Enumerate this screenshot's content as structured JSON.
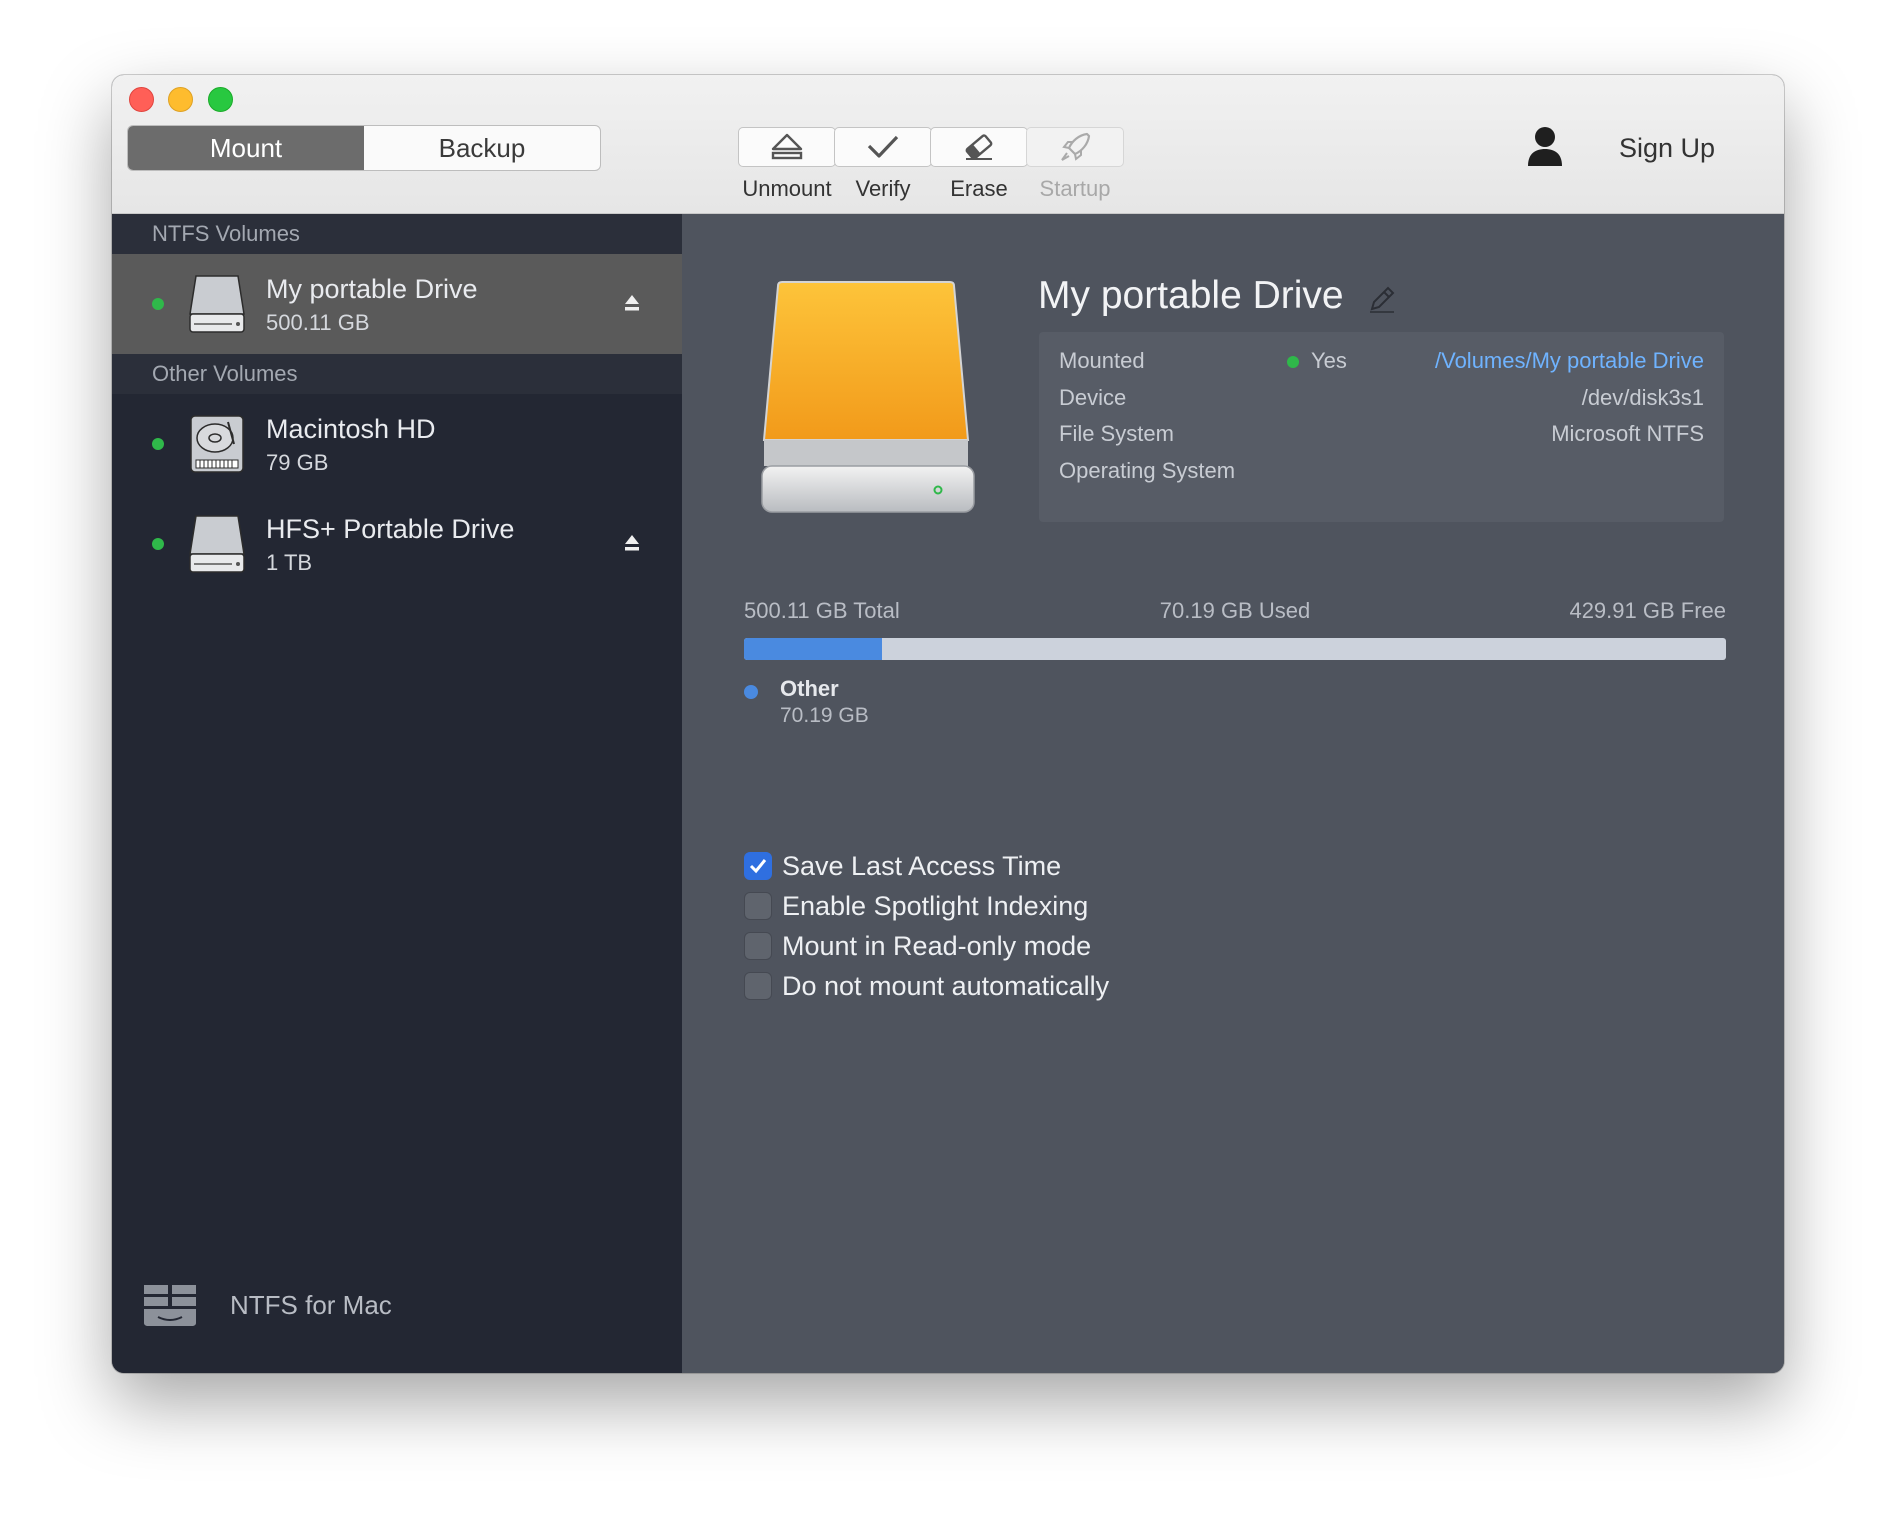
{
  "segments": {
    "mount": "Mount",
    "backup": "Backup"
  },
  "toolbar": {
    "unmount": "Unmount",
    "verify": "Verify",
    "erase": "Erase",
    "startup": "Startup"
  },
  "account": {
    "sign_up": "Sign Up"
  },
  "sidebar": {
    "ntfs_header": "NTFS Volumes",
    "other_header": "Other Volumes",
    "ntfs_volumes": [
      {
        "name": "My portable Drive",
        "size": "500.11 GB"
      }
    ],
    "other_volumes": [
      {
        "name": "Macintosh HD",
        "size": "79 GB"
      },
      {
        "name": "HFS+ Portable Drive",
        "size": "1 TB"
      }
    ],
    "brand": "NTFS for Mac"
  },
  "detail": {
    "title": "My portable Drive",
    "info": {
      "mounted_label": "Mounted",
      "mounted_value": "Yes",
      "mount_path": "/Volumes/My portable Drive",
      "device_label": "Device",
      "device_value": "/dev/disk3s1",
      "fs_label": "File System",
      "fs_value": "Microsoft NTFS",
      "os_label": "Operating System",
      "os_value": ""
    },
    "capacity": {
      "total": "500.11 GB Total",
      "used": "70.19 GB Used",
      "free": "429.91 GB Free",
      "used_fraction": 0.1403,
      "legend_name": "Other",
      "legend_size": "70.19 GB"
    },
    "options": [
      {
        "label": "Save Last Access Time",
        "checked": true
      },
      {
        "label": "Enable Spotlight Indexing",
        "checked": false
      },
      {
        "label": "Mount in Read-only mode",
        "checked": false
      },
      {
        "label": "Do not mount automatically",
        "checked": false
      }
    ]
  },
  "colors": {
    "accent_blue": "#4a8ae0",
    "status_green": "#2fb84a",
    "link_blue": "#6fb3ff",
    "drive_orange": "#f6a823"
  }
}
